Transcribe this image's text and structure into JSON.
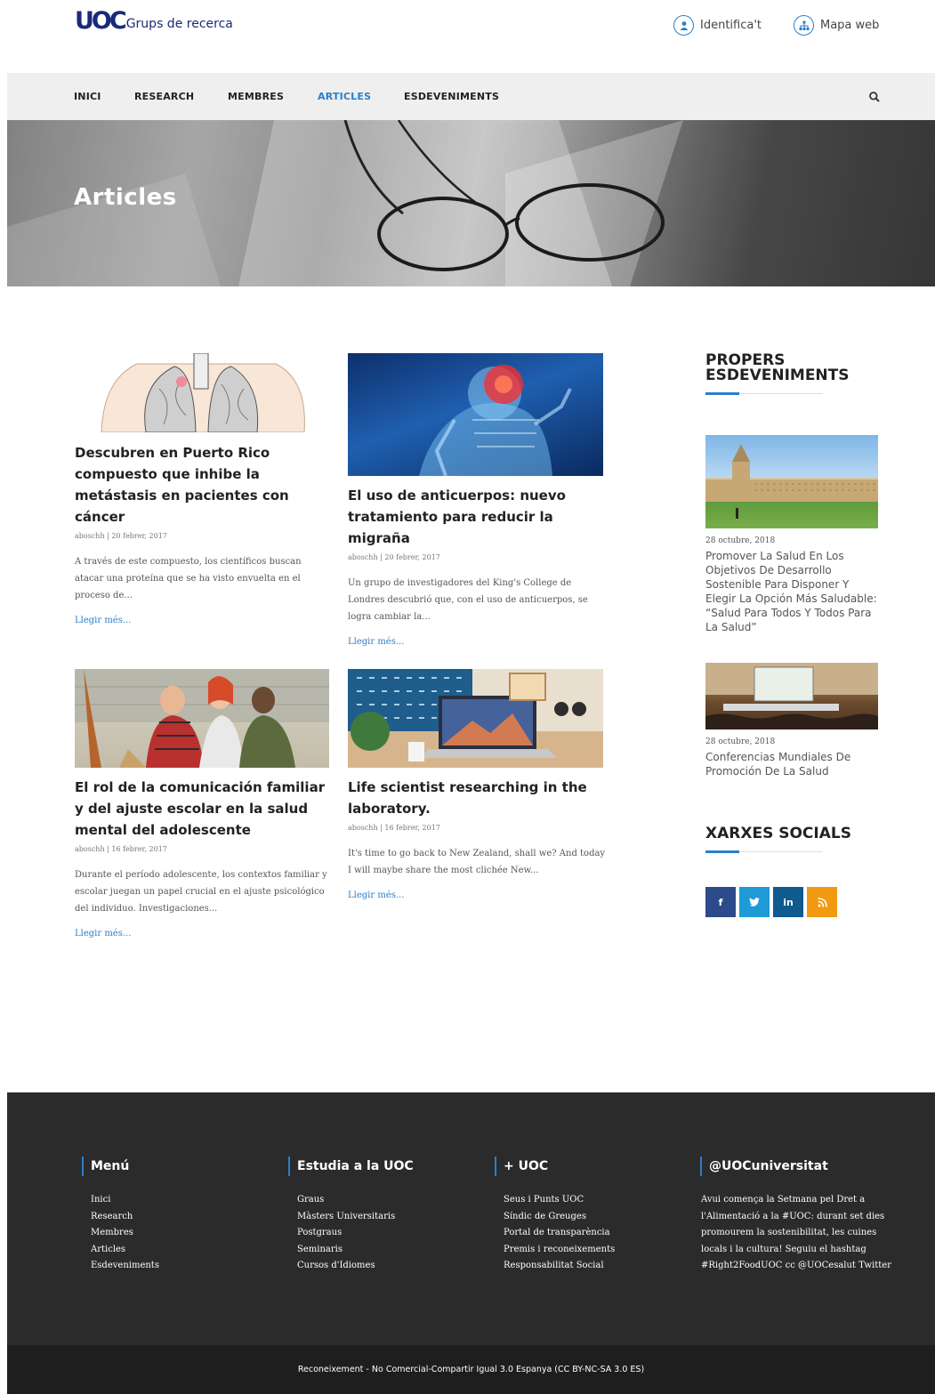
{
  "header": {
    "logo_mark": "UOC",
    "logo_text": "Grups de recerca",
    "login_label": "Identifica't",
    "sitemap_label": "Mapa web"
  },
  "nav": {
    "items": [
      "INICI",
      "RESEARCH",
      "MEMBRES",
      "ARTICLES",
      "ESDEVENIMENTS"
    ],
    "active": "ARTICLES"
  },
  "hero": {
    "title": "Articles"
  },
  "articles": [
    {
      "title": "Descubren en Puerto Rico compuesto que inhibe la metástasis en pacientes con cáncer",
      "author": "aboschh",
      "date": "20 febrer, 2017",
      "excerpt": "A través de este compuesto, los científicos buscan atacar una proteína que se ha visto envuelta en el proceso de...",
      "more": "Llegir més..."
    },
    {
      "title": "El uso de anticuerpos: nuevo tratamiento para reducir la migraña",
      "author": "aboschh",
      "date": "20 febrer, 2017",
      "excerpt": "Un grupo de investigadores del King's College de Londres descubrió que, con el uso de anticuerpos, se logra cambiar la...",
      "more": "Llegir més..."
    },
    {
      "title": "El rol de la comunicación familiar y del ajuste escolar en la salud mental del adolescente",
      "author": "aboschh",
      "date": "16 febrer, 2017",
      "excerpt": "Durante el período adolescente, los contextos familiar y escolar juegan un papel crucial en el ajuste psicológico del individuo. Investigaciones...",
      "more": "Llegir més..."
    },
    {
      "title": "Life scientist researching in the laboratory.",
      "author": "aboschh",
      "date": "16 febrer, 2017",
      "excerpt": "It's time to go back to New Zealand, shall we? And today I will maybe share the most clichée New...",
      "more": "Llegir més..."
    }
  ],
  "sidebar": {
    "events_title_line1": "PROPERS",
    "events_title_line2": "ESDEVENIMENTS",
    "events": [
      {
        "date": "28 octubre, 2018",
        "title": "Promover La Salud En Los Objetivos De Desarrollo Sostenible Para Disponer Y Elegir La Opción Más Saludable: “Salud Para Todos Y Todos Para La Salud”"
      },
      {
        "date": "28 octubre, 2018",
        "title": "Conferencias Mundiales De Promoción De La Salud"
      }
    ],
    "social_title": "XARXES SOCIALS",
    "social": [
      {
        "label": "f",
        "icon": "facebook-icon",
        "color": "#2d4a8a"
      },
      {
        "label": "t",
        "icon": "twitter-icon",
        "color": "#1e9ad6"
      },
      {
        "label": "in",
        "icon": "linkedin-icon",
        "color": "#0f5a8f"
      },
      {
        "label": "rss",
        "icon": "rss-icon",
        "color": "#f09a12"
      }
    ]
  },
  "footer": {
    "menu": {
      "title": "Menú",
      "items": [
        "Inici",
        "Research",
        "Membres",
        "Articles",
        "Esdeveniments"
      ]
    },
    "study": {
      "title": "Estudia a la UOC",
      "items": [
        "Graus",
        "Màsters Universitaris",
        "Postgraus",
        "Seminaris",
        "Cursos d'Idiomes"
      ]
    },
    "more": {
      "title": "+ UOC",
      "items": [
        "Seus i Punts UOC",
        "Síndic de Greuges",
        "Portal de transparència",
        "Premis i reconeixements",
        "Responsabilitat Social"
      ]
    },
    "twitter": {
      "title": "@UOCuniversitat",
      "text": "Avui comença la Setmana pel Dret a l'Alimentació a la #UOC: durant set dies promourem la sostenibilitat, les cuines locals i la cultura! Seguiu el hashtag #Right2FoodUOC cc @UOCesalut Twitter"
    },
    "license": "Reconeixement - No Comercial-Compartir Igual 3.0 Espanya (CC BY-NC-SA 3.0 ES)"
  },
  "colors": {
    "accent": "#2a7fc9",
    "footer": "#2b2b2b",
    "footer_bottom": "#1e1e1e",
    "logo": "#1a2a7a"
  }
}
